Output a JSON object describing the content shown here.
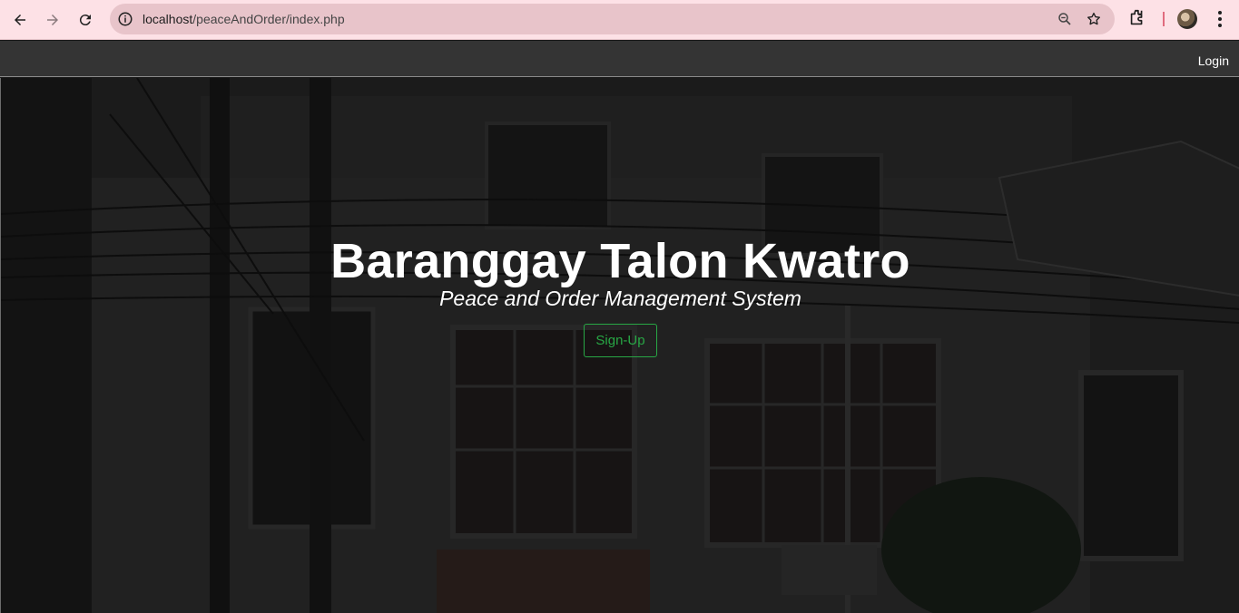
{
  "browser": {
    "url_host": "localhost",
    "url_path": "/peaceAndOrder/index.php"
  },
  "nav": {
    "login_label": "Login"
  },
  "hero": {
    "title": "Baranggay Talon Kwatro",
    "subtitle": "Peace and Order Management System",
    "signup_label": "Sign-Up"
  },
  "colors": {
    "browser_bar": "#fde1e6",
    "omnibox": "#e8c4ca",
    "nav_bg": "#343434",
    "signup_accent": "#28a745"
  }
}
